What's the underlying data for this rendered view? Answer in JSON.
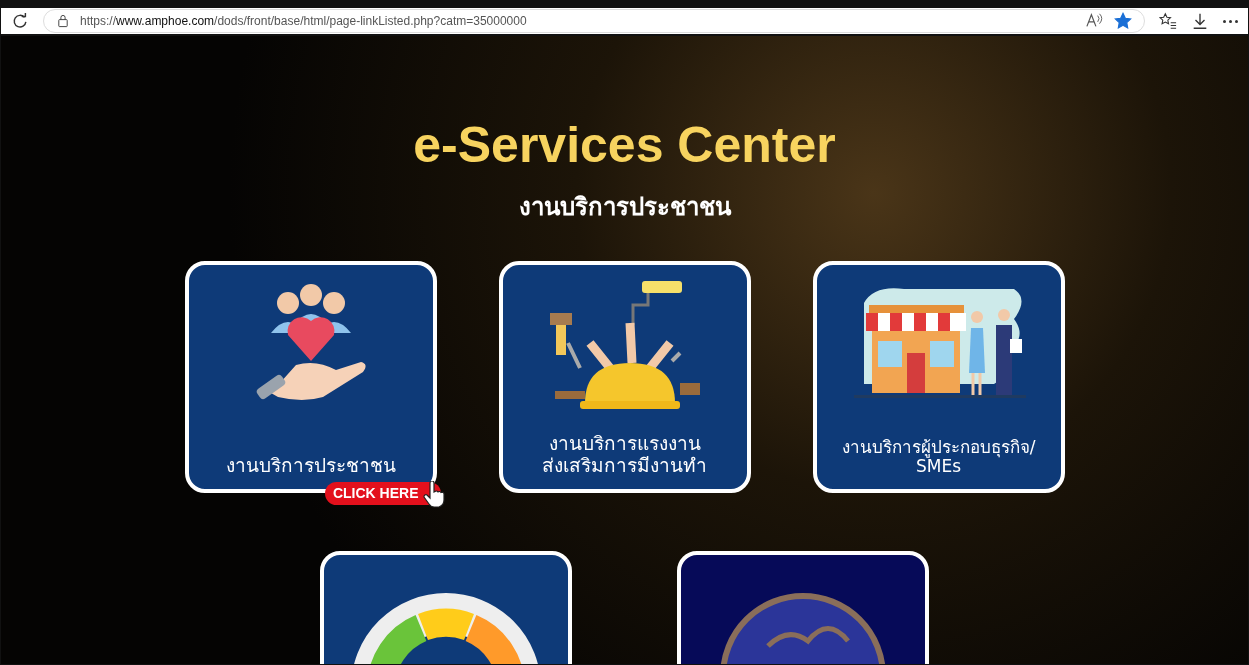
{
  "browser": {
    "url": "https://**www.amphoe.com**/dods/front/base/html/page-linkListed.php?catm=35000000",
    "favorited": true
  },
  "page": {
    "title": "e-Services Center",
    "subtitle": "งานบริการประชาชน"
  },
  "cards": [
    {
      "kind": "people",
      "lines": [
        "งานบริการประชาชน"
      ],
      "badge": "CLICK HERE"
    },
    {
      "kind": "labor",
      "lines": [
        "งานบริการแรงงาน",
        "ส่งเสริมการมีงานทำ"
      ]
    },
    {
      "kind": "business",
      "lines": [
        "งานบริการผู้ประกอบธุรกิจ/",
        "SMEs"
      ]
    },
    {
      "kind": "meter"
    },
    {
      "kind": "emblem"
    }
  ]
}
